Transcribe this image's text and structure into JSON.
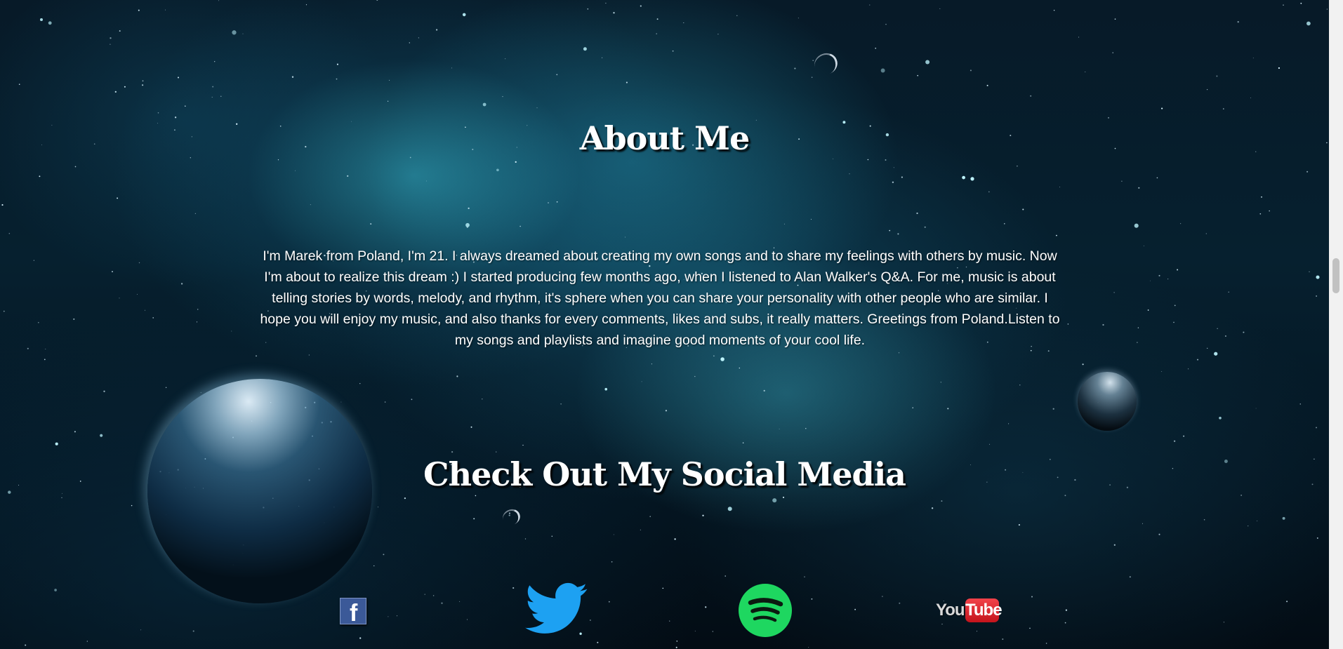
{
  "about": {
    "title": "About Me",
    "text": "I'm Marek from Poland, I'm 21. I always dreamed about creating my own songs and to share my feelings with others by music. Now I'm about to realize this dream :) I started producing few months ago, when I listened to Alan Walker's Q&A. For me, music is about telling stories by words, melody, and rhythm, it's sphere when you can share your personality with other people who are similar. I hope you will enjoy my music, and also thanks for every comments, likes and subs, it really matters. Greetings from Poland.Listen to my songs and playlists and imagine good moments of your cool life."
  },
  "social": {
    "title": "Check Out My Social Media",
    "links": [
      {
        "name": "Facebook",
        "icon": "facebook-icon",
        "glyph": "f",
        "color": "#3b5998"
      },
      {
        "name": "Twitter",
        "icon": "twitter-bird-icon",
        "color": "#1da1f2"
      },
      {
        "name": "Spotify",
        "icon": "spotify-icon",
        "color": "#1ed760"
      },
      {
        "name": "YouTube",
        "icon": "youtube-icon",
        "word_you": "You",
        "word_tube": "Tube",
        "color": "#e52d27"
      }
    ]
  },
  "theme": {
    "text_color": "#ffffff",
    "background": "space-nebula"
  }
}
